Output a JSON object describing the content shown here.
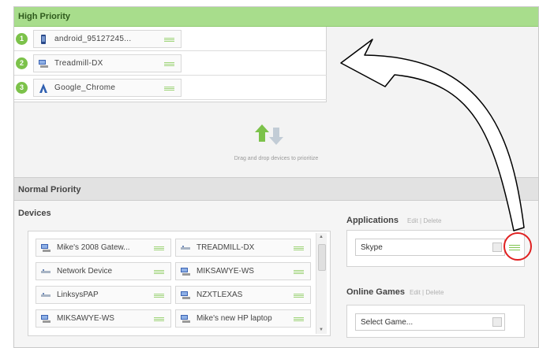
{
  "high_priority": {
    "title": "High Priority",
    "items": [
      {
        "num": "1",
        "label": "android_95127245...",
        "icon": "phone-icon"
      },
      {
        "num": "2",
        "label": "Treadmill-DX",
        "icon": "computer-icon"
      },
      {
        "num": "3",
        "label": "Google_Chrome",
        "icon": "app-icon"
      }
    ]
  },
  "drop_hint": "Drag and drop devices to prioritize",
  "normal_priority": {
    "title": "Normal Priority",
    "devices_title": "Devices",
    "devices": [
      {
        "label": "Mike's 2008 Gatew...",
        "icon": "computer-icon"
      },
      {
        "label": "TREADMILL-DX",
        "icon": "network-icon"
      },
      {
        "label": "Network Device",
        "icon": "network-icon"
      },
      {
        "label": "MIKSAWYE-WS",
        "icon": "computer-icon"
      },
      {
        "label": "LinksysPAP",
        "icon": "network-icon"
      },
      {
        "label": "NZXTLEXAS",
        "icon": "computer-icon"
      },
      {
        "label": "MIKSAWYE-WS",
        "icon": "computer-icon"
      },
      {
        "label": "Mike's new HP laptop",
        "icon": "computer-icon"
      }
    ],
    "applications": {
      "title": "Applications",
      "edit": "Edit",
      "sep": "|",
      "delete": "Delete",
      "selected": "Skype"
    },
    "online_games": {
      "title": "Online Games",
      "edit": "Edit",
      "sep": "|",
      "delete": "Delete",
      "placeholder": "Select Game..."
    }
  },
  "colors": {
    "header_green": "#a8dd8c",
    "badge_green": "#7cc24a",
    "annotation_red": "#e02020"
  }
}
